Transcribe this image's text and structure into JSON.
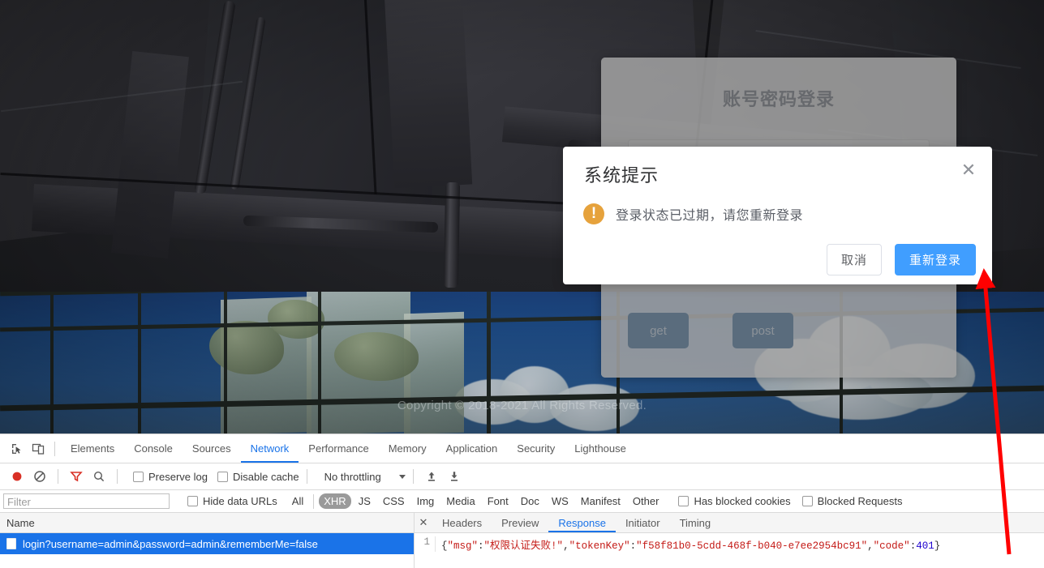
{
  "login_page": {
    "card_title": "账号密码登录",
    "username_value": "",
    "username_placeholder": "",
    "get_button": "get",
    "post_button": "post",
    "copyright": "Copyright © 2018-2021 All Rights Reserved."
  },
  "messagebox": {
    "title": "系统提示",
    "close_icon": "close-icon",
    "warn_icon": "warning-icon",
    "warn_glyph": "!",
    "message": "登录状态已过期，请您重新登录",
    "cancel_label": "取消",
    "confirm_label": "重新登录",
    "accent_color": "#409EFF",
    "warn_color": "#E6A23C"
  },
  "devtools": {
    "left_icons": [
      {
        "name": "inspect-element-icon"
      },
      {
        "name": "device-toolbar-icon"
      }
    ],
    "tabs": [
      {
        "label": "Elements",
        "active": false
      },
      {
        "label": "Console",
        "active": false
      },
      {
        "label": "Sources",
        "active": false
      },
      {
        "label": "Network",
        "active": true
      },
      {
        "label": "Performance",
        "active": false
      },
      {
        "label": "Memory",
        "active": false
      },
      {
        "label": "Application",
        "active": false
      },
      {
        "label": "Security",
        "active": false
      },
      {
        "label": "Lighthouse",
        "active": false
      }
    ],
    "toolbar": {
      "record_icon": "record-icon",
      "clear_icon": "clear-icon",
      "filter_icon": "filter-icon",
      "search_icon": "search-icon",
      "preserve_log": "Preserve log",
      "preserve_log_checked": false,
      "disable_cache": "Disable cache",
      "disable_cache_checked": false,
      "throttling": "No throttling",
      "import_icon": "import-har-icon",
      "export_icon": "export-har-icon"
    },
    "filterbar": {
      "filter_placeholder": "Filter",
      "filter_value": "",
      "hide_data_urls": "Hide data URLs",
      "hide_data_urls_checked": false,
      "types": [
        {
          "label": "All",
          "active": false
        },
        {
          "label": "XHR",
          "active": true
        },
        {
          "label": "JS",
          "active": false
        },
        {
          "label": "CSS",
          "active": false
        },
        {
          "label": "Img",
          "active": false
        },
        {
          "label": "Media",
          "active": false
        },
        {
          "label": "Font",
          "active": false
        },
        {
          "label": "Doc",
          "active": false
        },
        {
          "label": "WS",
          "active": false
        },
        {
          "label": "Manifest",
          "active": false
        },
        {
          "label": "Other",
          "active": false
        }
      ],
      "has_blocked_cookies": "Has blocked cookies",
      "has_blocked_cookies_checked": false,
      "blocked_requests": "Blocked Requests",
      "blocked_requests_checked": false
    },
    "request_list": {
      "column_header": "Name",
      "rows": [
        {
          "name": "login?username=admin&password=admin&rememberMe=false",
          "selected": true
        }
      ]
    },
    "detail": {
      "close_icon": "close-icon",
      "tabs": [
        {
          "label": "Headers",
          "active": false
        },
        {
          "label": "Preview",
          "active": false
        },
        {
          "label": "Response",
          "active": true
        },
        {
          "label": "Initiator",
          "active": false
        },
        {
          "label": "Timing",
          "active": false
        }
      ],
      "response": {
        "line_number": "1",
        "raw": "{\"msg\":\"权限认证失败!\",\"tokenKey\":\"f58f81b0-5cdd-468f-b040-e7ee2954bc91\",\"code\":401}",
        "tokens": {
          "open_brace": "{",
          "key_msg": "\"msg\"",
          "val_msg": "\"权限认证失败!\"",
          "key_token": "\"tokenKey\"",
          "val_token": "\"f58f81b0-5cdd-468f-b040-e7ee2954bc91\"",
          "key_code": "\"code\"",
          "val_code": "401",
          "close_brace": "}",
          "colon": ":",
          "comma": ","
        }
      }
    }
  },
  "annotation": {
    "arrow_color": "#ff0000",
    "arrow_from": "401",
    "arrow_to": "重新登录"
  }
}
